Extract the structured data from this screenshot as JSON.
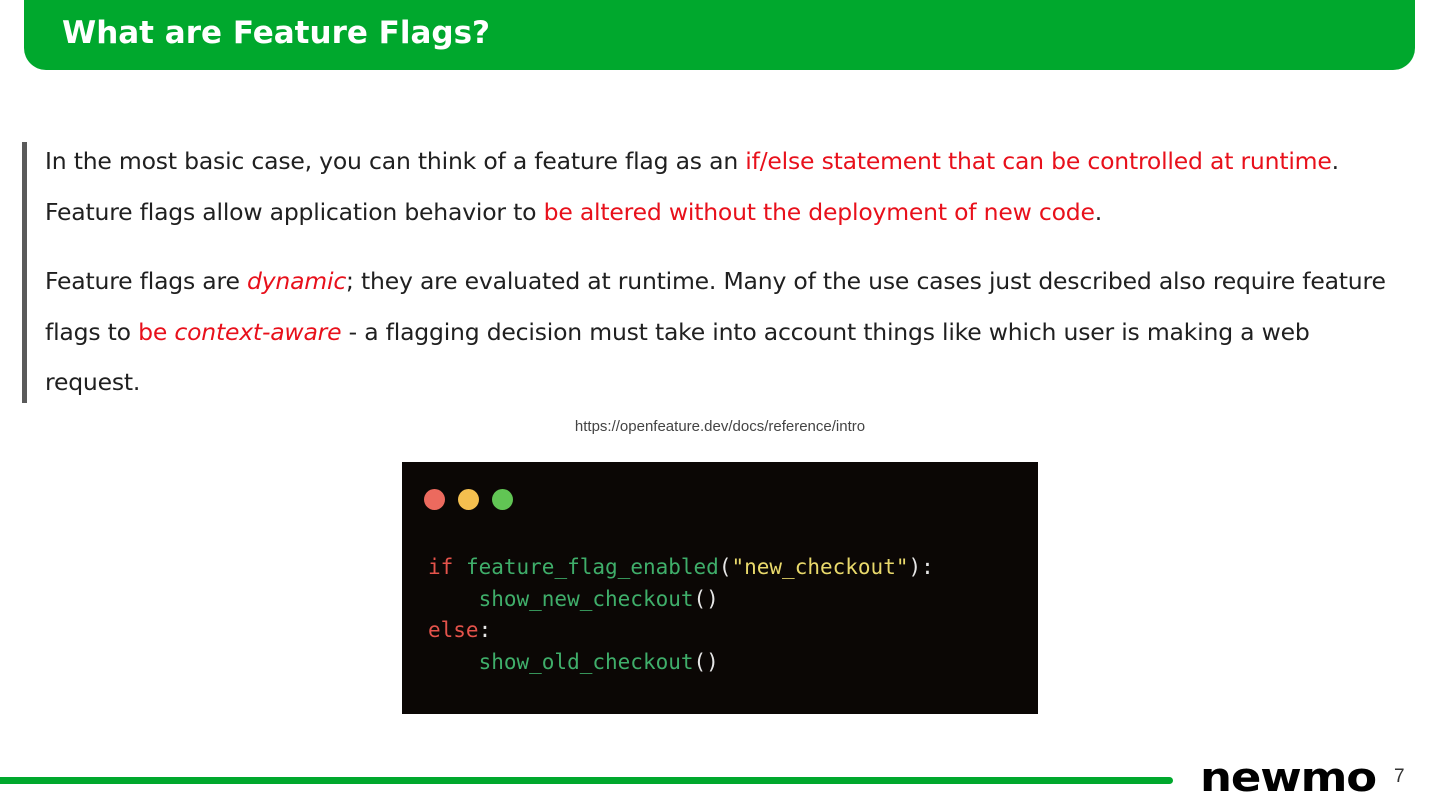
{
  "header": {
    "title": "What are Feature Flags?",
    "accent_color": "#00a82d"
  },
  "body": {
    "paragraph1": {
      "s1": "In the most basic case, you can think of a feature flag as an ",
      "s2": "if/else statement that can be controlled at runtime",
      "s3": ". Feature flags allow application behavior to ",
      "s4": "be altered without the deployment of new code",
      "s5": "."
    },
    "paragraph2": {
      "s1": "Feature flags are ",
      "s2": "dynamic",
      "s3": "; they are evaluated at runtime. Many of the use cases just described also require feature flags to ",
      "s4": "be ",
      "s5": "context-aware",
      "s6": " - a flagging decision must take into account things like which user is making a web request."
    },
    "highlight_color": "#e8101b"
  },
  "source": {
    "url": "https://openfeature.dev/docs/reference/intro"
  },
  "code_window": {
    "line1": {
      "kw": "if",
      "fn": "feature_flag_enabled",
      "open": "(",
      "str": "\"new_checkout\"",
      "close": "):"
    },
    "line2": {
      "fn": "show_new_checkout",
      "parens": "()"
    },
    "line3": {
      "kw": "else",
      "colon": ":"
    },
    "line4": {
      "fn": "show_old_checkout",
      "parens": "()"
    }
  },
  "footer": {
    "logo_text": "newmo",
    "page_number": "7"
  }
}
